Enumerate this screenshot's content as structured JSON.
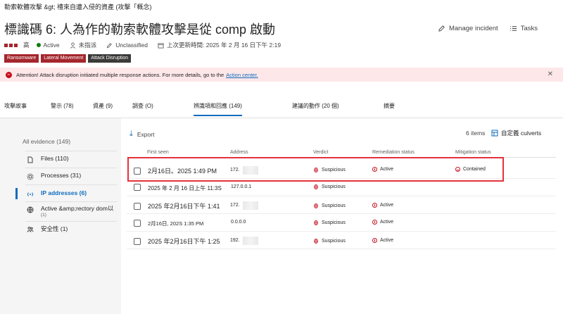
{
  "breadcrumb": "勒索軟體攻擊 &gt; 禮來自遭入侵的資產 (攻擊「概念)",
  "title": "標識碼 6: 人為作的勒索軟體攻擊是從 comp 啟動",
  "header_actions": {
    "manage": "Manage incident",
    "tasks": "Tasks"
  },
  "meta": {
    "severity": "高",
    "status": "Active",
    "assigned": "未指派",
    "classification": "Unclassified",
    "last_update": "上次更新時間: 2025 年 2 月 16 日下午 2:19"
  },
  "tags": [
    "Ransomware",
    "Lateral Movement",
    "Attack Disruption"
  ],
  "banner": {
    "text": "Attention! Attack disruption initiated multiple response actions. For more details, go to the",
    "link": "Action center."
  },
  "tabs": [
    {
      "label": "攻擊故事"
    },
    {
      "label": "警示 (78)"
    },
    {
      "label": "資產 (9)"
    },
    {
      "label": "調查 (O)"
    },
    {
      "label": "辨識項和回應 (149)"
    },
    {
      "label": "建議的動作 (20 個)"
    },
    {
      "label": "摘要"
    }
  ],
  "sidebar": {
    "all": "All evidence (149)",
    "items": [
      {
        "label": "Files (110)",
        "icon": "file-icon"
      },
      {
        "label": "Processes (31)",
        "icon": "gear-icon"
      },
      {
        "label": "IP addresses (6)",
        "icon": "wifi-icon"
      },
      {
        "label": "Active &amp;rectory dom以",
        "sub": "(1)",
        "icon": "globe-icon"
      },
      {
        "label": "安全性 (1)",
        "icon": "users-icon"
      }
    ]
  },
  "toolbar": {
    "export": "Export",
    "count": "6 items",
    "customize": "自定義 culverts"
  },
  "columns": {
    "first_seen": "First seen",
    "address": "Address",
    "verdict": "Verdict",
    "remediation": "Remediation status",
    "mitigation": "Mitigation status"
  },
  "rows": [
    {
      "first_seen": "2月16日。2025 1:49 PM",
      "address": "172.",
      "verdict": "Suspicious",
      "remediation": "Active",
      "mitigation": "Contained"
    },
    {
      "first_seen": "2025 年 2 月 16 日上午 11:3S",
      "address": "127.0.0.1",
      "verdict": "Suspicious",
      "remediation": "",
      "mitigation": ""
    },
    {
      "first_seen": "2025 年2月16日下午 1:41",
      "address": "172.",
      "verdict": "Suspicious",
      "remediation": "Active",
      "mitigation": ""
    },
    {
      "first_seen": "2月16日, 202S 1:35 PM",
      "address": "0.0.0.0",
      "verdict": "Suspicious",
      "remediation": "Active",
      "mitigation": ""
    },
    {
      "first_seen": "2025 年2月16日下午 1:25",
      "address": "192.",
      "verdict": "Suspicious",
      "remediation": "Active",
      "mitigation": ""
    }
  ],
  "colors": {
    "accent": "#0f6cbd",
    "danger": "#c50f1f",
    "severity": "#a4262c",
    "banner_bg": "#fde7e9",
    "highlight": "#e5323b"
  }
}
